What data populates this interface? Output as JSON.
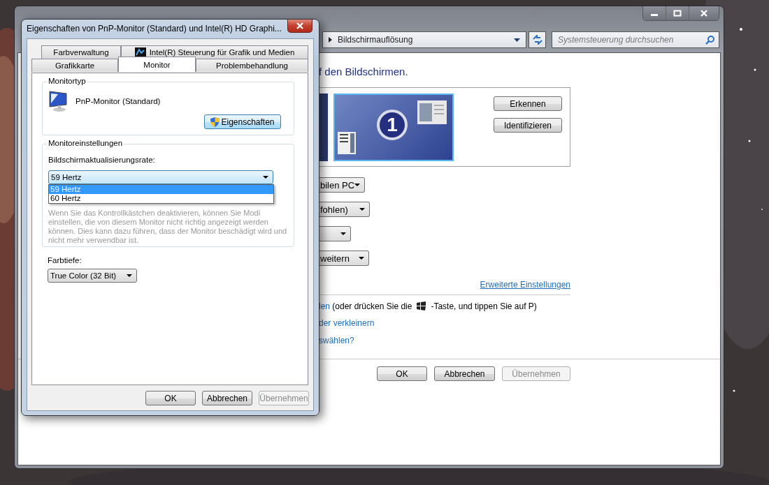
{
  "main_window": {
    "breadcrumb": "Bildschirmauflösung",
    "search": {
      "placeholder": "Systemsteuerung durchsuchen"
    },
    "heading": "f den Bildschirmen.",
    "monitor_number": "1",
    "side_buttons": [
      "Erkennen",
      "Identifizieren"
    ],
    "dropdowns": [
      {
        "kind": "text",
        "value": "bilen PC"
      },
      {
        "kind": "text",
        "value": "fohlen)"
      },
      {
        "kind": "blank"
      },
      {
        "kind": "text",
        "value": "weitern"
      }
    ],
    "advanced_link": "Erweiterte Einstellungen",
    "hint": {
      "link": "len",
      "before_icon": "(oder drücken Sie die",
      "after_icon": "-Taste, und tippen Sie auf P)"
    },
    "links": [
      "der verkleinern",
      "swählen?"
    ],
    "buttons": [
      {
        "label": "OK",
        "disabled": false
      },
      {
        "label": "Abbrechen",
        "disabled": false
      },
      {
        "label": "Übernehmen",
        "disabled": true
      }
    ]
  },
  "dialog": {
    "title": "Eigenschaften von PnP-Monitor (Standard) und Intel(R) HD Graphi...",
    "tab_rows": [
      [
        {
          "label": "Farbverwaltung",
          "selected": false,
          "has_icon": false
        },
        {
          "label": "Intel(R) Steuerung für Grafik und Medien",
          "selected": false,
          "has_icon": true
        }
      ],
      [
        {
          "label": "Grafikkarte",
          "selected": false,
          "has_icon": false
        },
        {
          "label": "Monitor",
          "selected": true,
          "has_icon": false
        },
        {
          "label": "Problembehandlung",
          "selected": false,
          "has_icon": false
        }
      ]
    ],
    "monitor_type": {
      "legend": "Monitortyp",
      "name": "PnP-Monitor (Standard)",
      "button": "Eigenschaften"
    },
    "monitor_settings": {
      "legend": "Monitoreinstellungen",
      "refresh_label": "Bildschirmaktualisierungsrate:",
      "refresh_value": "59 Hertz",
      "expanded": true,
      "options": [
        {
          "label": "59 Hertz",
          "selected": true
        },
        {
          "label": "60 Hertz",
          "selected": false
        }
      ],
      "warning": "Wenn Sie das Kontrollkästchen deaktivieren, können Sie Modi einstellen, die von diesem Monitor nicht richtig angezeigt werden können. Dies kann dazu führen, dass der Monitor beschädigt wird und nicht mehr verwendbar ist."
    },
    "color_depth": {
      "label": "Farbtiefe:",
      "value": "True Color (32 Bit)"
    },
    "buttons": [
      {
        "label": "OK",
        "disabled": false
      },
      {
        "label": "Abbrechen",
        "disabled": false
      },
      {
        "label": "Übernehmen",
        "disabled": true
      }
    ]
  }
}
